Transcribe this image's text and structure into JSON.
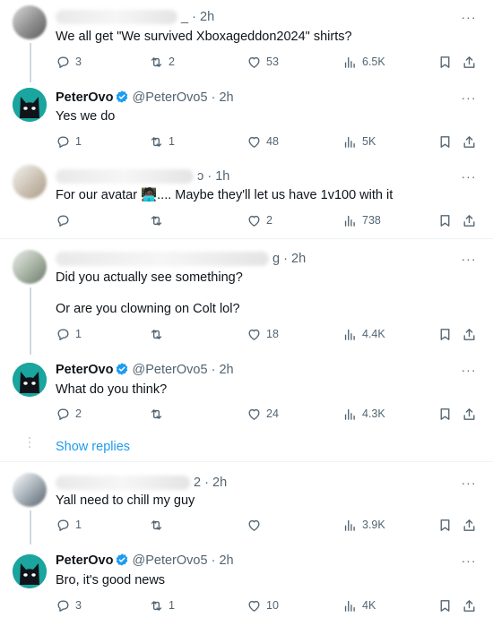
{
  "tweets": [
    {
      "id": "t1",
      "time": "2h",
      "handle_tail": "_",
      "text": "We all get \"We survived Xboxageddon2024\" shirts?",
      "replies": "3",
      "retweets": "2",
      "likes": "53",
      "views": "6.5K"
    },
    {
      "id": "t2",
      "name": "PeterOvo",
      "handle": "@PeterOvo5",
      "time": "2h",
      "text": "Yes we do",
      "replies": "1",
      "retweets": "1",
      "likes": "48",
      "views": "5K"
    },
    {
      "id": "t3",
      "time": "1h",
      "handle_tail": "ɔ",
      "text": "For our avatar 🧑🏿‍💻.... Maybe they'll let us have 1v100 with it",
      "replies": "",
      "retweets": "",
      "likes": "2",
      "views": "738"
    },
    {
      "id": "t4",
      "time": "2h",
      "handle_tail": "g",
      "text": "Did you actually see something?",
      "text2": "Or are you clowning on Colt lol?",
      "replies": "1",
      "retweets": "",
      "likes": "18",
      "views": "4.4K"
    },
    {
      "id": "t5",
      "name": "PeterOvo",
      "handle": "@PeterOvo5",
      "time": "2h",
      "text": "What do you think?",
      "replies": "2",
      "retweets": "",
      "likes": "24",
      "views": "4.3K"
    },
    {
      "id": "t6",
      "time": "2h",
      "handle_tail": "2",
      "text": "Yall need to chill my guy",
      "replies": "1",
      "retweets": "",
      "likes": "",
      "views": "3.9K"
    },
    {
      "id": "t7",
      "name": "PeterOvo",
      "handle": "@PeterOvo5",
      "time": "2h",
      "text": "Bro, it's good news",
      "replies": "3",
      "retweets": "1",
      "likes": "10",
      "views": "4K"
    }
  ],
  "show_replies_label": "Show replies",
  "separator": "·",
  "more_glyph": "···",
  "colors": {
    "accent": "#1d9bf0",
    "muted": "#536471",
    "avatar_bg": "#1aa59e"
  },
  "icons": [
    "reply-icon",
    "retweet-icon",
    "like-icon",
    "views-icon",
    "bookmark-icon",
    "share-icon",
    "verified-badge-icon",
    "more-icon"
  ]
}
